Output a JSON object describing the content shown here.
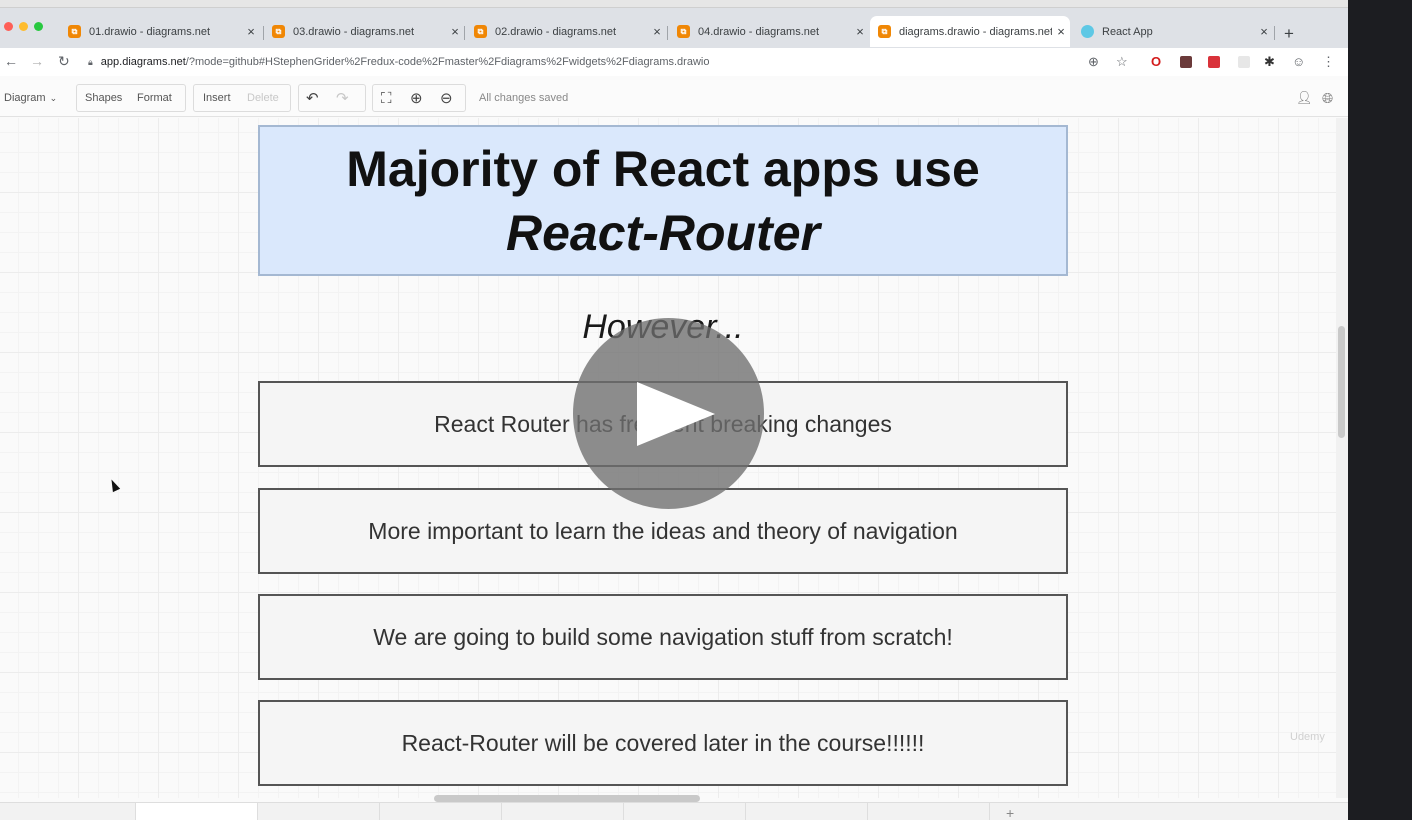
{
  "browser": {
    "tabs": [
      {
        "title": "01.drawio - diagrams.net",
        "icon": "drawio-icon"
      },
      {
        "title": "03.drawio - diagrams.net",
        "icon": "drawio-icon"
      },
      {
        "title": "02.drawio - diagrams.net",
        "icon": "drawio-icon"
      },
      {
        "title": "04.drawio - diagrams.net",
        "icon": "drawio-icon"
      },
      {
        "title": "diagrams.drawio - diagrams.net",
        "icon": "drawio-icon",
        "active": true
      },
      {
        "title": "React App",
        "icon": "react-icon"
      }
    ],
    "close_glyph": "×",
    "new_tab_glyph": "+",
    "url_host": "app.diagrams.net",
    "url_rest": "/?mode=github#HStephenGrider%2Fredux-code%2Fmaster%2Fdiagrams%2Fwidgets%2Fdiagrams.drawio"
  },
  "toolbar": {
    "diagram_menu": "Diagram",
    "shapes": "Shapes",
    "format": "Format",
    "insert": "Insert",
    "delete": "Delete",
    "status": "All changes saved"
  },
  "slide": {
    "title_line1": "Majority of React apps use",
    "title_line2": "React-Router",
    "however": "However...",
    "items": [
      "React Router has frequent breaking changes",
      "More important to learn the ideas and theory of navigation",
      "We are going to build some navigation stuff from scratch!",
      "React-Router will be covered later in the course!!!!!!"
    ]
  },
  "video": {
    "watermark": "Udemy"
  },
  "colors": {
    "title_fill": "#dae8fc",
    "title_stroke": "#a4b8d2",
    "item_fill": "#f5f5f5",
    "item_stroke": "#555555",
    "drawio_orange": "#f08705"
  }
}
